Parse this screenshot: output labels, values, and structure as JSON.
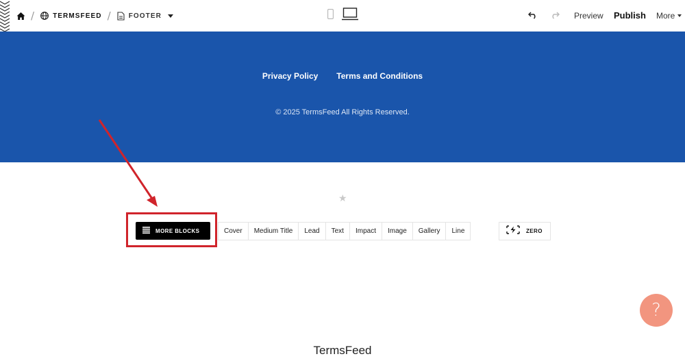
{
  "toolbar": {
    "breadcrumbs": {
      "home_icon": "home-icon",
      "site_icon": "globe-icon",
      "site_label": "TERMSFEED",
      "page_icon": "page-icon",
      "page_label": "FOOTER",
      "separator": "/"
    },
    "devices": [
      "mobile-icon",
      "laptop-icon"
    ],
    "undo_icon": "undo-icon",
    "redo_icon": "redo-icon",
    "preview_label": "Preview",
    "publish_label": "Publish",
    "more_label": "More"
  },
  "footer_block": {
    "background": "#1a55ab",
    "links": [
      "Privacy Policy",
      "Terms and Conditions"
    ],
    "copyright": "© 2025 TermsFeed All Rights Reserved."
  },
  "block_picker": {
    "more_blocks_label": "MORE BLOCKS",
    "tabs": [
      "Cover",
      "Medium Title",
      "Lead",
      "Text",
      "Impact",
      "Image",
      "Gallery",
      "Line"
    ],
    "zero_label": "ZERO",
    "annotation_color": "#d0242b"
  },
  "help_button": {
    "label": "?",
    "color": "#f2957f"
  },
  "caption": "TermsFeed"
}
